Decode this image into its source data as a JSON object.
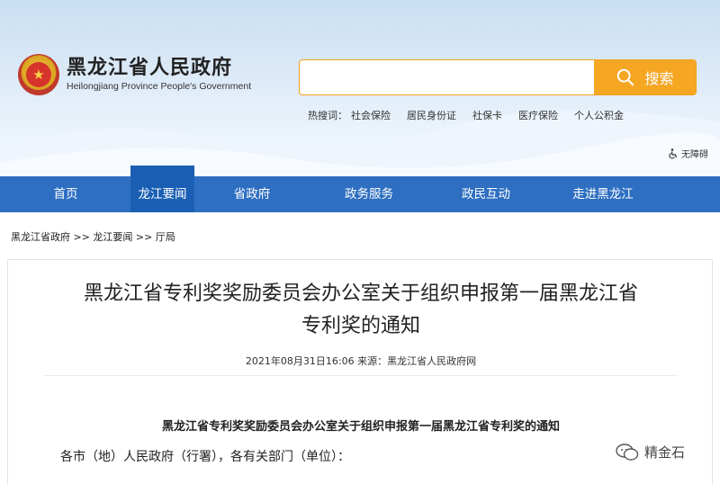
{
  "header": {
    "site_name_cn": "黑龙江省人民政府",
    "site_name_en": "Heilongjiang Province People's Government",
    "emblem_glyph": "★"
  },
  "search": {
    "placeholder": "",
    "button_label": "搜索",
    "hot_label": "热搜词：",
    "hot_words": [
      "社会保险",
      "居民身份证",
      "社保卡",
      "医疗保险",
      "个人公积金"
    ]
  },
  "accessibility": {
    "label": "无障碍"
  },
  "nav": {
    "items": [
      "首页",
      "龙江要闻",
      "省政府",
      "政务服务",
      "政民互动",
      "走进黑龙江"
    ],
    "active_index": 1
  },
  "breadcrumb": {
    "text": "黑龙江省政府 >> 龙江要闻 >> 厅局"
  },
  "article": {
    "title_line1": "黑龙江省专利奖奖励委员会办公室关于组织申报第一届黑龙江省",
    "title_line2": "专利奖的通知",
    "meta": "2021年08月31日16:06  来源：黑龙江省人民政府网",
    "subtitle": "黑龙江省专利奖奖励委员会办公室关于组织申报第一届黑龙江省专利奖的通知",
    "salutation": "各市（地）人民政府（行署），各有关部门（单位）："
  },
  "watermark": {
    "label": "精金石"
  },
  "colors": {
    "nav_bg": "#2e6fc2",
    "nav_active": "#1a5fb4",
    "search_accent": "#f5a623"
  }
}
